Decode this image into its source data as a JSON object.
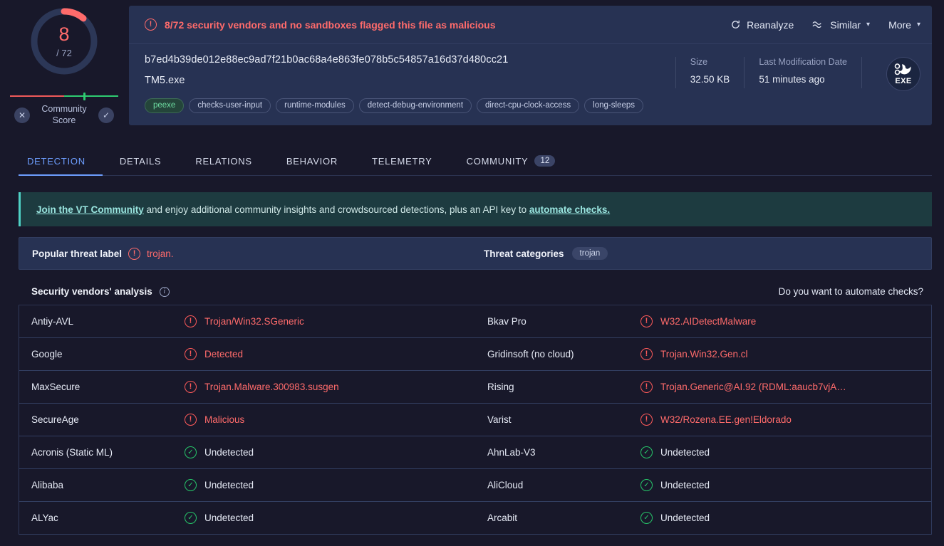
{
  "score": {
    "detections": "8",
    "total": "/ 72",
    "detections_num": 8,
    "total_num": 72,
    "community_label": "Community Score",
    "dislike_icon": "x-circle-icon",
    "like_icon": "check-circle-icon",
    "accent_malicious": "#ff6b6b",
    "accent_safe": "#2ecc71"
  },
  "header": {
    "alert_icon": "warning-circle-icon",
    "alert_text": "8/72 security vendors and no sandboxes flagged this file as malicious",
    "actions": [
      {
        "label": "Reanalyze",
        "icon": "refresh-icon",
        "has_chevron": false
      },
      {
        "label": "Similar",
        "icon": "similar-waves-icon",
        "has_chevron": true
      },
      {
        "label": "More",
        "icon": "",
        "has_chevron": true
      }
    ],
    "hash": "b7ed4b39de012e88ec9ad7f21b0ac68a4e863fe078b5c54857a16d37d480cc21",
    "filename": "TM5.exe",
    "tags": [
      {
        "label": "peexe",
        "highlight": true
      },
      {
        "label": "checks-user-input",
        "highlight": false
      },
      {
        "label": "runtime-modules",
        "highlight": false
      },
      {
        "label": "detect-debug-environment",
        "highlight": false
      },
      {
        "label": "direct-cpu-clock-access",
        "highlight": false
      },
      {
        "label": "long-sleeps",
        "highlight": false
      }
    ],
    "meta": [
      {
        "key": "Size",
        "value": "32.50 KB"
      },
      {
        "key": "Last Modification Date",
        "value": "51 minutes ago"
      }
    ],
    "file_type_badge": {
      "label": "EXE",
      "icon": "exe-file-icon"
    }
  },
  "tabs": [
    {
      "label": "DETECTION",
      "active": true,
      "badge": ""
    },
    {
      "label": "DETAILS",
      "active": false,
      "badge": ""
    },
    {
      "label": "RELATIONS",
      "active": false,
      "badge": ""
    },
    {
      "label": "BEHAVIOR",
      "active": false,
      "badge": ""
    },
    {
      "label": "TELEMETRY",
      "active": false,
      "badge": ""
    },
    {
      "label": "COMMUNITY",
      "active": false,
      "badge": "12"
    }
  ],
  "banner": {
    "link1": "Join the VT Community",
    "middle": " and enjoy additional community insights and crowdsourced detections, plus an API key to ",
    "link2": "automate checks.",
    "accent": "#4fd1c5"
  },
  "threat_panel": {
    "label": "Popular threat label",
    "value": "trojan.",
    "value_icon": "warning-circle-icon",
    "categories_label": "Threat categories",
    "categories": [
      "trojan"
    ]
  },
  "vendors_header": {
    "title": "Security vendors' analysis",
    "info_icon": "info-icon",
    "automate_link": "Do you want to automate checks?"
  },
  "vendors": [
    {
      "left": {
        "name": "Antiy-AVL",
        "result": "Trojan/Win32.SGeneric",
        "status": "malicious"
      },
      "right": {
        "name": "Bkav Pro",
        "result": "W32.AIDetectMalware",
        "status": "malicious"
      }
    },
    {
      "left": {
        "name": "Google",
        "result": "Detected",
        "status": "malicious"
      },
      "right": {
        "name": "Gridinsoft (no cloud)",
        "result": "Trojan.Win32.Gen.cl",
        "status": "malicious"
      }
    },
    {
      "left": {
        "name": "MaxSecure",
        "result": "Trojan.Malware.300983.susgen",
        "status": "malicious"
      },
      "right": {
        "name": "Rising",
        "result": "Trojan.Generic@AI.92 (RDML:aaucb7vjA…",
        "status": "malicious"
      }
    },
    {
      "left": {
        "name": "SecureAge",
        "result": "Malicious",
        "status": "malicious"
      },
      "right": {
        "name": "Varist",
        "result": "W32/Rozena.EE.gen!Eldorado",
        "status": "malicious"
      }
    },
    {
      "left": {
        "name": "Acronis (Static ML)",
        "result": "Undetected",
        "status": "undetected"
      },
      "right": {
        "name": "AhnLab-V3",
        "result": "Undetected",
        "status": "undetected"
      }
    },
    {
      "left": {
        "name": "Alibaba",
        "result": "Undetected",
        "status": "undetected"
      },
      "right": {
        "name": "AliCloud",
        "result": "Undetected",
        "status": "undetected"
      }
    },
    {
      "left": {
        "name": "ALYac",
        "result": "Undetected",
        "status": "undetected"
      },
      "right": {
        "name": "Arcabit",
        "result": "Undetected",
        "status": "undetected"
      }
    }
  ]
}
